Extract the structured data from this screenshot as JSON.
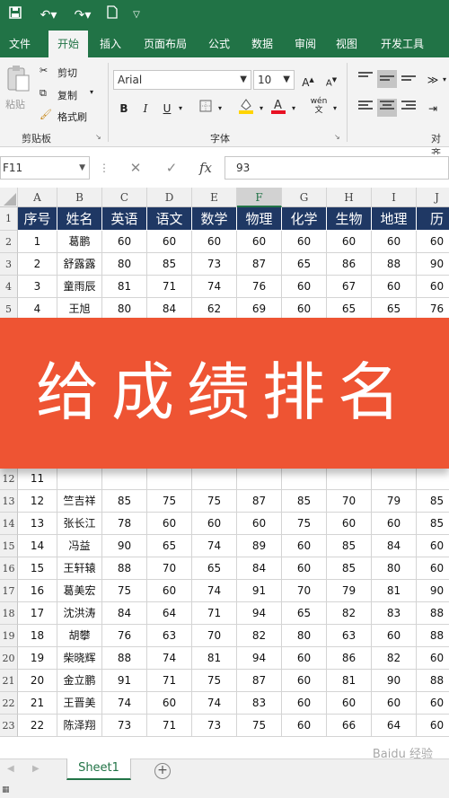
{
  "quick_access": {
    "save_icon": "floppy-disk-icon",
    "undo_icon": "undo-icon",
    "redo_icon": "redo-icon",
    "new_icon": "new-document-icon",
    "customize_icon": "chevron-down-icon"
  },
  "ribbon_tabs": [
    "文件",
    "开始",
    "插入",
    "页面布局",
    "公式",
    "数据",
    "审阅",
    "视图",
    "开发工具"
  ],
  "active_tab": "开始",
  "clipboard": {
    "paste": "粘贴",
    "cut": "剪切",
    "copy": "复制",
    "format_painter": "格式刷",
    "group_label": "剪贴板"
  },
  "font": {
    "name": "Arial",
    "size": "10",
    "bold": "B",
    "italic": "I",
    "underline": "U",
    "group_label": "字体",
    "font_color_hex": "#e81123",
    "fill_color_hex": "#ffd400",
    "increase": "A",
    "decrease": "A",
    "phonetic": "wén"
  },
  "alignment": {
    "group_label": "对齐"
  },
  "formula_bar": {
    "name_box": "F11",
    "fx": "fx",
    "value": "93"
  },
  "columns": [
    "A",
    "B",
    "C",
    "D",
    "E",
    "F",
    "G",
    "H",
    "I",
    "J"
  ],
  "selected_column": "F",
  "header_row": [
    "序号",
    "姓名",
    "英语",
    "语文",
    "数学",
    "物理",
    "化学",
    "生物",
    "地理",
    "历"
  ],
  "top_rows": [
    {
      "num": "2",
      "cells": [
        "1",
        "葛鹏",
        "60",
        "60",
        "60",
        "60",
        "60",
        "60",
        "60",
        "60"
      ]
    },
    {
      "num": "3",
      "cells": [
        "2",
        "舒露露",
        "80",
        "85",
        "73",
        "87",
        "65",
        "86",
        "88",
        "90"
      ]
    },
    {
      "num": "4",
      "cells": [
        "3",
        "童雨辰",
        "81",
        "71",
        "74",
        "76",
        "60",
        "67",
        "60",
        "60"
      ]
    },
    {
      "num": "5",
      "cells": [
        "4",
        "王旭",
        "80",
        "84",
        "62",
        "69",
        "60",
        "65",
        "65",
        "76"
      ]
    }
  ],
  "bottom_rows": [
    {
      "num": "12",
      "cells": [
        "11",
        "",
        "",
        "",
        "",
        "",
        "",
        "",
        "",
        ""
      ]
    },
    {
      "num": "13",
      "cells": [
        "12",
        "竺吉祥",
        "85",
        "75",
        "75",
        "87",
        "85",
        "70",
        "79",
        "85"
      ]
    },
    {
      "num": "14",
      "cells": [
        "13",
        "张长江",
        "78",
        "60",
        "60",
        "60",
        "75",
        "60",
        "60",
        "85"
      ]
    },
    {
      "num": "15",
      "cells": [
        "14",
        "冯益",
        "90",
        "65",
        "74",
        "89",
        "60",
        "85",
        "84",
        "60"
      ]
    },
    {
      "num": "16",
      "cells": [
        "15",
        "王轩辕",
        "88",
        "70",
        "65",
        "84",
        "60",
        "85",
        "80",
        "60"
      ]
    },
    {
      "num": "17",
      "cells": [
        "16",
        "葛美宏",
        "75",
        "60",
        "74",
        "91",
        "70",
        "79",
        "81",
        "90"
      ]
    },
    {
      "num": "18",
      "cells": [
        "17",
        "沈洪涛",
        "84",
        "64",
        "71",
        "94",
        "65",
        "82",
        "83",
        "88"
      ]
    },
    {
      "num": "19",
      "cells": [
        "18",
        "胡攀",
        "76",
        "63",
        "70",
        "82",
        "80",
        "63",
        "60",
        "88"
      ]
    },
    {
      "num": "20",
      "cells": [
        "19",
        "柴晓辉",
        "88",
        "74",
        "81",
        "94",
        "60",
        "86",
        "82",
        "60"
      ]
    },
    {
      "num": "21",
      "cells": [
        "20",
        "金立鹏",
        "91",
        "71",
        "75",
        "87",
        "60",
        "81",
        "90",
        "88"
      ]
    },
    {
      "num": "22",
      "cells": [
        "21",
        "王晋美",
        "74",
        "60",
        "74",
        "83",
        "60",
        "60",
        "60",
        "60"
      ]
    },
    {
      "num": "23",
      "cells": [
        "22",
        "陈泽翔",
        "73",
        "71",
        "73",
        "75",
        "60",
        "66",
        "64",
        "60"
      ]
    }
  ],
  "banner": {
    "text": "给成绩排名",
    "color": "#ee5433"
  },
  "sheet_tab": "Sheet1",
  "watermark": "Baidu 经验",
  "colors": {
    "excel_green": "#217346",
    "header_fill": "#1f3864"
  }
}
